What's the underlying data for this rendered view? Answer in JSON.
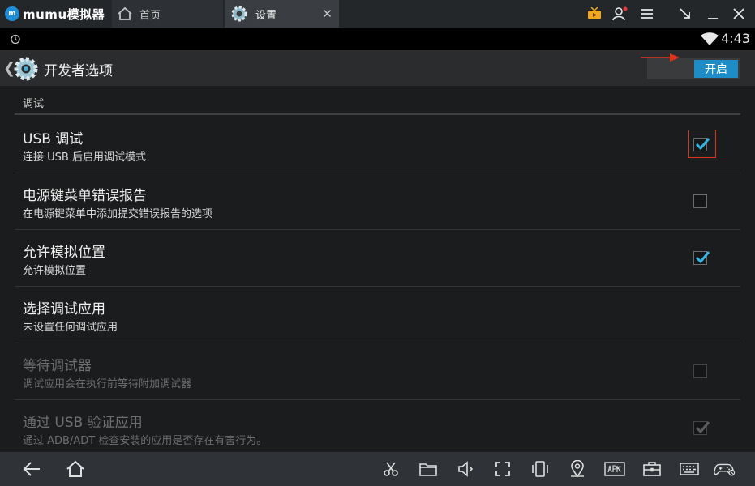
{
  "app": {
    "logo_text": "mumu模拟器"
  },
  "tabs": [
    {
      "label": "首页",
      "icon": "home-icon"
    },
    {
      "label": "设置",
      "icon": "gear-icon",
      "close": "✕"
    }
  ],
  "status": {
    "time": "4:43"
  },
  "action_bar": {
    "title": "开发者选项",
    "switch_label": "开启"
  },
  "section": {
    "title": "调试"
  },
  "rows": [
    {
      "title": "USB 调试",
      "subtitle": "连接 USB 后启用调试模式",
      "checked": true,
      "enabled": true
    },
    {
      "title": "电源键菜单错误报告",
      "subtitle": "在电源键菜单中添加提交错误报告的选项",
      "checked": false,
      "enabled": true
    },
    {
      "title": "允许模拟位置",
      "subtitle": "允许模拟位置",
      "checked": true,
      "enabled": true
    },
    {
      "title": "选择调试应用",
      "subtitle": "未设置任何调试应用",
      "enabled": true
    },
    {
      "title": "等待调试器",
      "subtitle": "调试应用会在执行前等待附加调试器",
      "checked": false,
      "enabled": false
    },
    {
      "title": "通过 USB 验证应用",
      "subtitle": "通过 ADB/ADT 检查安装的应用是否存在有害行为。",
      "checked": true,
      "enabled": false
    }
  ],
  "colors": {
    "accent": "#1d8cc7",
    "highlight": "#e0331c",
    "check": "#33b5e5"
  }
}
